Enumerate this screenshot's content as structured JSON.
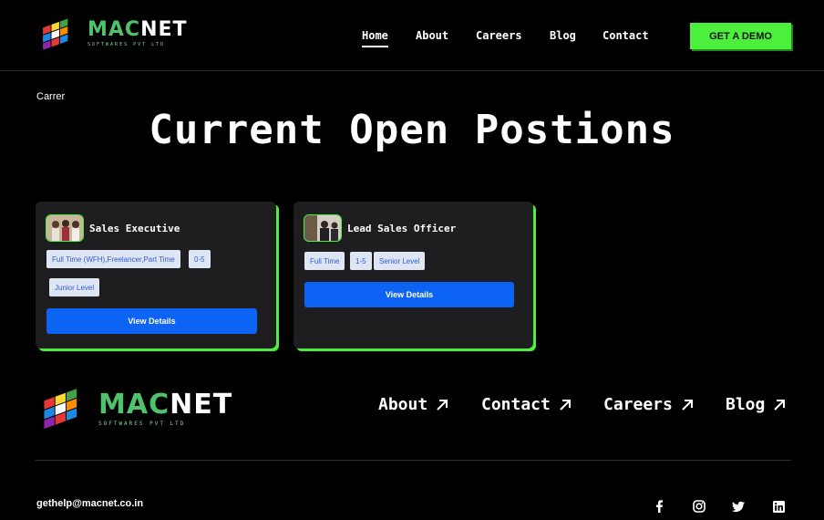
{
  "brand": {
    "name_part1": "MAC",
    "name_part2": "NET",
    "tagline": "SOFTWARES PVT LTD"
  },
  "nav": {
    "items": [
      {
        "label": "Home",
        "active": true
      },
      {
        "label": "About"
      },
      {
        "label": "Careers"
      },
      {
        "label": "Blog"
      },
      {
        "label": "Contact"
      }
    ],
    "cta": "GET A DEMO"
  },
  "breadcrumb": "Carrer",
  "page_title": "Current Open Postions",
  "jobs": [
    {
      "title": "Sales Executive",
      "tags": [
        "Full Time (WFH),Freelancer,Part Time",
        "0-5",
        "Junior Level"
      ],
      "button": "View Details"
    },
    {
      "title": "Lead Sales Officer",
      "tags": [
        "Full Time",
        "1-5",
        "Senior Level"
      ],
      "button": "View Details"
    }
  ],
  "footer": {
    "links": [
      "About",
      "Contact",
      "Careers",
      "Blog"
    ],
    "email": "gethelp@macnet.co.in",
    "social": [
      "facebook-icon",
      "instagram-icon",
      "twitter-icon",
      "linkedin-icon"
    ]
  },
  "colors": {
    "accent_green": "#4cf03c",
    "button_blue": "#0d63f3",
    "card_bg": "#1e1d1f",
    "tag_bg": "#dfe6f3",
    "tag_text": "#2c5bd8"
  }
}
